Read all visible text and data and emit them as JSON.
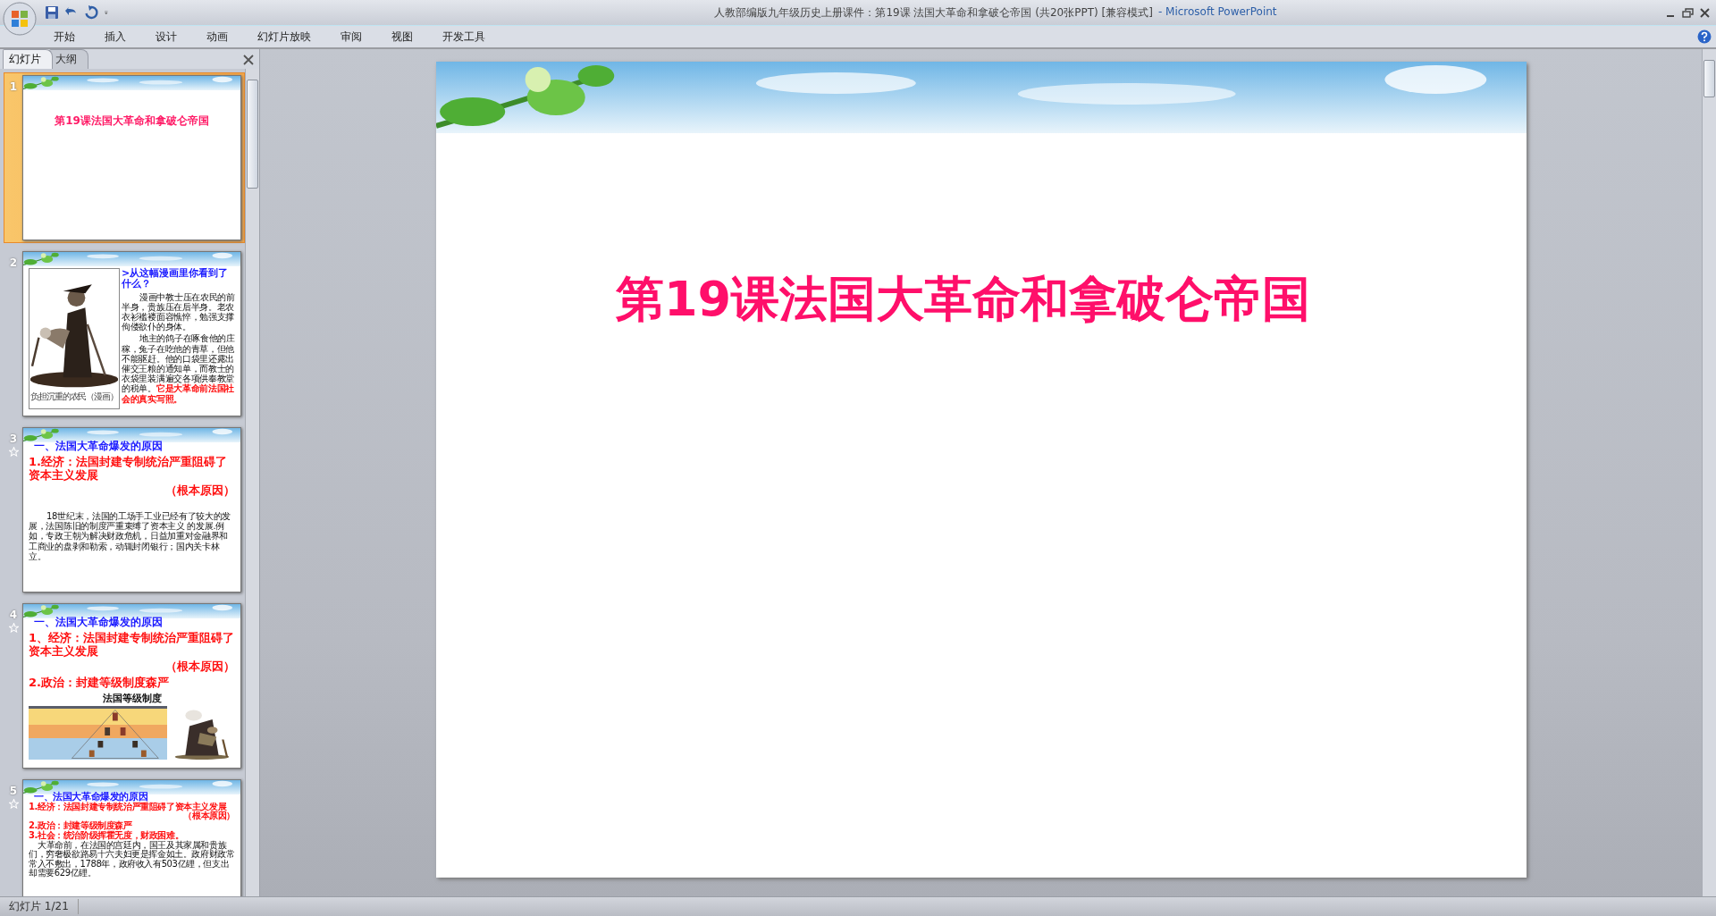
{
  "window": {
    "title": "人教部编版九年级历史上册课件：第19课 法国大革命和拿破仑帝国 (共20张PPT) [兼容模式]",
    "app_name": "- Microsoft PowerPoint"
  },
  "ribbon_tabs": [
    {
      "label": "开始"
    },
    {
      "label": "插入"
    },
    {
      "label": "设计"
    },
    {
      "label": "动画"
    },
    {
      "label": "幻灯片放映"
    },
    {
      "label": "审阅"
    },
    {
      "label": "视图"
    },
    {
      "label": "开发工具"
    }
  ],
  "pane_tabs": [
    {
      "label": "幻灯片",
      "selected": true
    },
    {
      "label": "大纲",
      "selected": false
    }
  ],
  "slides": [
    {
      "number": "1",
      "selected": true,
      "animated": false,
      "kind": "title",
      "blocks": [
        {
          "kind": "title",
          "text": "第19课法国大革命和拿破仑帝国"
        }
      ]
    },
    {
      "number": "2",
      "selected": false,
      "animated": false,
      "kind": "split",
      "caption": "负担沉重的农民（漫画）",
      "blocks": [
        {
          "kind": "question",
          "text": ">从这幅漫画里你看到了什么？"
        },
        {
          "kind": "body",
          "text": "漫画中教士压在农民的前半身，贵族压在后半身。老农衣衫褴褛面容憔悴，勉强支撑佝偻欲仆的身体。"
        },
        {
          "kind": "body",
          "text": "地主的鸽子在啄食他的庄稼，兔子在吃他的青草，但他不能驱赶。他的口袋里还露出催交王粮的通知单，而教士的衣袋里装满遍交各项供奉教堂的税单。**它是大革命前法国社会的真实写照。**"
        }
      ]
    },
    {
      "number": "3",
      "selected": false,
      "animated": true,
      "kind": "stack",
      "blocks": [
        {
          "kind": "heading",
          "text": "一、法国大革命爆发的原因"
        },
        {
          "kind": "point",
          "text": "1.经济：法国封建专制统治严重阻碍了资本主义发展"
        },
        {
          "kind": "note",
          "text": "（根本原因）"
        },
        {
          "kind": "body",
          "text": "18世纪末，法国的工场手工业已经有了较大的发展，法国陈旧的制度严重束缚了资本主义 的发展.例如，专政王朝为解决财政危机，日益加重对金融界和工商业的盘剥和勒索，动辄封闭银行；国内关卡林立。"
        }
      ]
    },
    {
      "number": "4",
      "selected": false,
      "animated": true,
      "kind": "stack",
      "blocks": [
        {
          "kind": "heading",
          "text": "一、法国大革命爆发的原因"
        },
        {
          "kind": "point",
          "text": "1、经济：法国封建专制统治严重阻碍了资本主义发展"
        },
        {
          "kind": "note",
          "text": "（根本原因）"
        },
        {
          "kind": "point",
          "text": "2.政治：封建等级制度森严"
        },
        {
          "kind": "label",
          "text": "法国等级制度"
        },
        {
          "kind": "figures"
        }
      ]
    },
    {
      "number": "5",
      "selected": false,
      "animated": true,
      "kind": "dense",
      "blocks": [
        {
          "kind": "heading",
          "text": "一、法国大革命爆发的原因"
        },
        {
          "kind": "point",
          "text": "1.经济：法国封建专制统治严重阻碍了资本主义发展"
        },
        {
          "kind": "note",
          "text": "（根本原因）"
        },
        {
          "kind": "point",
          "text": "2.政治：封建等级制度森严"
        },
        {
          "kind": "point",
          "text": "3.社会：统治阶级挥霍无度，财政困难。"
        },
        {
          "kind": "body",
          "text": "大革命前，在法国的宫廷内，国王及其家属和贵族们，穷奢极欲路易十六夫妇更是挥金如土。政府财政常常入不敷出，1788年，政府收入有503亿锂，但支出却需要629亿锂。"
        }
      ]
    }
  ],
  "editor": {
    "title": "第19课法国大革命和拿破仑帝国"
  },
  "status_bar": {
    "text": "幻灯片 1/21"
  }
}
